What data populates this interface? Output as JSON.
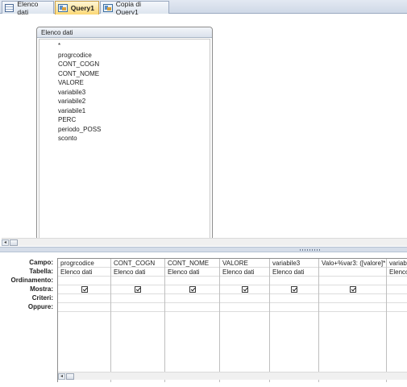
{
  "tabs": [
    {
      "label": "Elenco dati",
      "icon": "table-icon",
      "active": false
    },
    {
      "label": "Query1",
      "icon": "query-icon",
      "active": true
    },
    {
      "label": "Copia di Query1",
      "icon": "query-icon",
      "active": false
    }
  ],
  "table_box": {
    "title": "Elenco dati",
    "fields": [
      "*",
      "progrcodice",
      "CONT_COGN",
      "CONT_NOME",
      "VALORE",
      "variabile3",
      "variabile2",
      "variabile1",
      "PERC",
      "periodo_POSS",
      "sconto"
    ]
  },
  "row_labels": [
    "Campo:",
    "Tabella:",
    "Ordinamento:",
    "Mostra:",
    "Criteri:",
    "Oppure:"
  ],
  "columns": [
    {
      "campo": "progrcodice",
      "tabella": "Elenco dati",
      "mostra": true
    },
    {
      "campo": "CONT_COGN",
      "tabella": "Elenco dati",
      "mostra": true
    },
    {
      "campo": "CONT_NOME",
      "tabella": "Elenco dati",
      "mostra": true
    },
    {
      "campo": "VALORE",
      "tabella": "Elenco dati",
      "mostra": true
    },
    {
      "campo": "variabile3",
      "tabella": "Elenco dati",
      "mostra": true
    },
    {
      "campo": "Valo+%var3: ([valore]*",
      "tabella": "",
      "mostra": true
    },
    {
      "campo": "variab",
      "tabella": "Elenco",
      "mostra": false
    }
  ],
  "scroll_arrows": {
    "left": "◂",
    "thumb": "|||"
  }
}
